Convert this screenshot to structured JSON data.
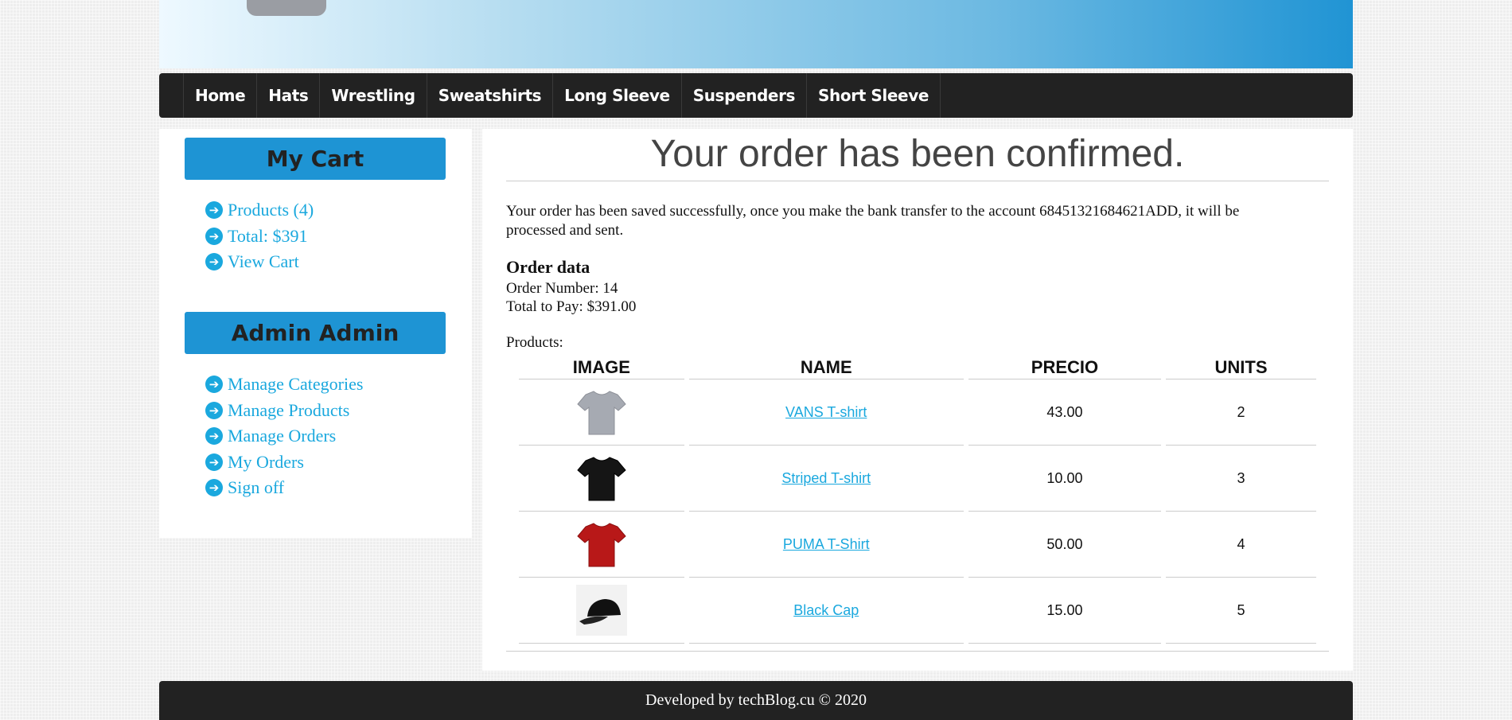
{
  "nav": {
    "items": [
      "Home",
      "Hats",
      "Wrestling",
      "Sweatshirts",
      "Long Sleeve",
      "Suspenders",
      "Short Sleeve"
    ]
  },
  "cart": {
    "title": "My Cart",
    "links": [
      "Products (4)",
      "Total: $391",
      "View Cart"
    ]
  },
  "admin": {
    "title": "Admin Admin",
    "links": [
      "Manage Categories",
      "Manage Products",
      "Manage Orders",
      "My Orders",
      "Sign off"
    ]
  },
  "main": {
    "title": "Your order has been confirmed.",
    "message": "Your order has been saved successfully, once you make the bank transfer to the account 68451321684621ADD, it will be processed and sent.",
    "order_heading": "Order data",
    "order_number": "Order Number: 14",
    "total_to_pay": "Total to Pay: $391.00",
    "products_label": "Products:"
  },
  "table": {
    "headers": [
      "IMAGE",
      "NAME",
      "PRECIO",
      "UNITS"
    ],
    "rows": [
      {
        "image": "grey-tshirt",
        "name": "VANS T-shirt",
        "price": "43.00",
        "units": "2"
      },
      {
        "image": "black-tshirt",
        "name": "Striped T-shirt",
        "price": "10.00",
        "units": "3"
      },
      {
        "image": "red-tshirt",
        "name": "PUMA T-Shirt",
        "price": "50.00",
        "units": "4"
      },
      {
        "image": "black-cap",
        "name": "Black Cap",
        "price": "15.00",
        "units": "5"
      }
    ]
  },
  "footer": {
    "text": "Developed by techBlog.cu © 2020"
  },
  "colors": {
    "accent": "#1e94d4",
    "link": "#1aa8de",
    "nav_bg": "#222222"
  }
}
